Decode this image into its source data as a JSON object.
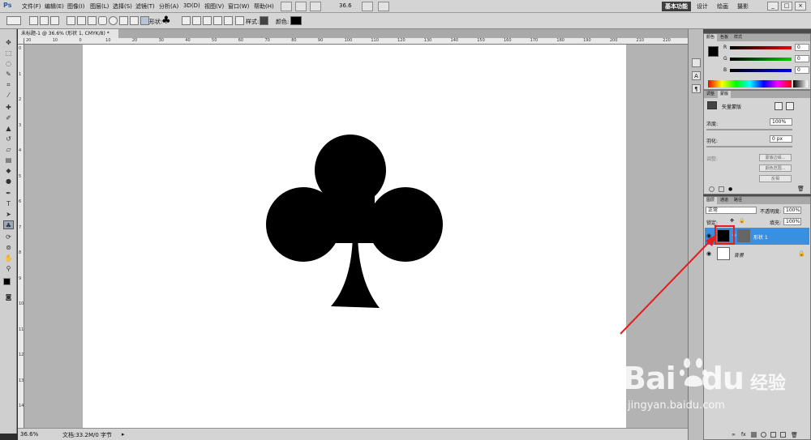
{
  "app": {
    "logo": "Ps",
    "menus": [
      "文件(F)",
      "编辑(E)",
      "图像(I)",
      "图层(L)",
      "选择(S)",
      "滤镜(T)",
      "分析(A)",
      "3D(D)",
      "视图(V)",
      "窗口(W)",
      "帮助(H)"
    ],
    "zoom_display": "36.6",
    "workspaces": [
      "基本功能",
      "设计",
      "绘画",
      "摄影"
    ],
    "active_workspace": "基本功能",
    "window_buttons": [
      "_",
      "□",
      "×"
    ]
  },
  "options_bar": {
    "shape_label": "形状:",
    "style_label": "样式:",
    "color_label": "颜色:",
    "color_value": "#000000"
  },
  "document": {
    "tab_title": "未标题-1 @ 36.6% (形状 1, CMYK/8) *",
    "ruler_top_ticks": [
      "20",
      "10",
      "0",
      "10",
      "20",
      "30",
      "40",
      "50",
      "60",
      "70",
      "80",
      "90",
      "100",
      "110",
      "120",
      "130",
      "140",
      "150",
      "160",
      "170",
      "180",
      "190",
      "200",
      "210",
      "220"
    ],
    "ruler_left_ticks": [
      "0",
      "1",
      "2",
      "3",
      "4",
      "5",
      "6",
      "7",
      "8",
      "9",
      "10",
      "11",
      "12",
      "13",
      "14"
    ],
    "canvas_shape": "club-shape",
    "status_zoom": "36.6%",
    "status_doc": "文档:33.2M/0 字节"
  },
  "color_panel": {
    "tabs": [
      "颜色",
      "色板",
      "样式"
    ],
    "channels": [
      {
        "label": "R",
        "value": "0"
      },
      {
        "label": "G",
        "value": "0"
      },
      {
        "label": "B",
        "value": "0"
      }
    ],
    "foreground": "#000000"
  },
  "masks_panel": {
    "tabs": [
      "调整",
      "蒙版"
    ],
    "title": "矢量蒙版",
    "density_label": "浓度:",
    "density_value": "100%",
    "feather_label": "羽化:",
    "feather_value": "0 px",
    "refine_label": "调整:",
    "buttons": [
      "蒙版边缘...",
      "颜色范围...",
      "反相"
    ]
  },
  "layers_panel": {
    "tabs": [
      "图层",
      "通道",
      "路径"
    ],
    "blend_mode": "正常",
    "opacity_label": "不透明度:",
    "opacity_value": "100%",
    "lock_label": "锁定:",
    "fill_label": "填充:",
    "fill_value": "100%",
    "layers": [
      {
        "name": "形状 1",
        "selected": true
      },
      {
        "name": "背景",
        "selected": false
      }
    ]
  },
  "watermark": {
    "brand": "Bai",
    "brand2": "du",
    "cn": "经验",
    "url": "jingyan.baidu.com"
  }
}
